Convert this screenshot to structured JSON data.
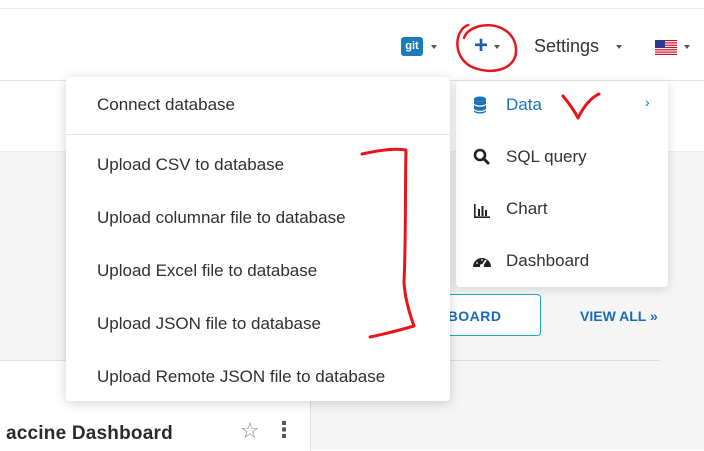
{
  "header": {
    "git_badge": "git",
    "plus": "+",
    "settings_label": "Settings"
  },
  "add_menu": {
    "items": [
      {
        "label": "Data",
        "icon": "database-icon",
        "has_submenu": true,
        "active": true
      },
      {
        "label": "SQL query",
        "icon": "search-icon"
      },
      {
        "label": "Chart",
        "icon": "bar-chart-icon"
      },
      {
        "label": "Dashboard",
        "icon": "dashboard-icon"
      }
    ],
    "chevron": "›"
  },
  "data_submenu": {
    "items": [
      {
        "label": "Connect database"
      },
      {
        "label": "Upload CSV to database"
      },
      {
        "label": "Upload columnar file to database"
      },
      {
        "label": "Upload Excel file to database"
      },
      {
        "label": "Upload JSON file to database"
      },
      {
        "label": "Upload Remote JSON file to database"
      }
    ]
  },
  "background": {
    "dashboard_button_label": "HBOARD",
    "view_all_label": "VIEW ALL »",
    "card_title": "accine Dashboard"
  },
  "colors": {
    "accent": "#1a73b8",
    "annotation": "#e8141b",
    "git_badge": "#1b7ab8"
  }
}
